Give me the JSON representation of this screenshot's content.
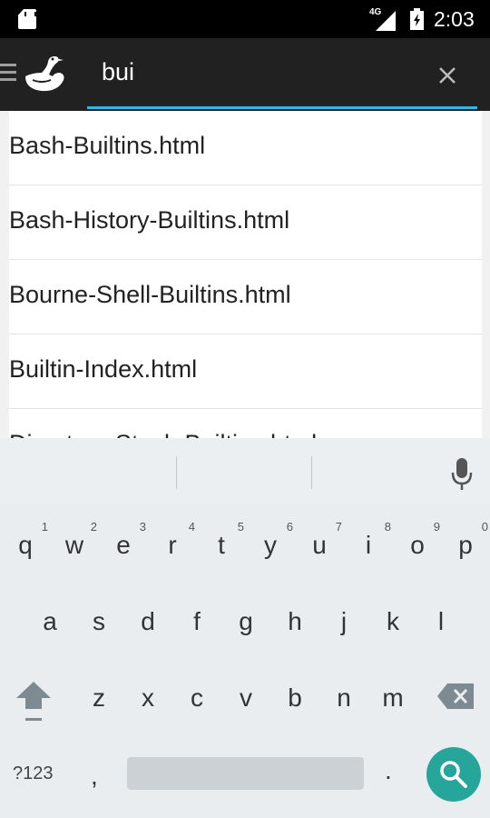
{
  "status_bar": {
    "network": "4G",
    "time": "2:03",
    "icons": [
      "sd-card-icon",
      "signal-icon",
      "battery-charging-icon"
    ]
  },
  "search": {
    "query": "bui",
    "icons": [
      "menu-icon",
      "duck-logo-icon",
      "clear-icon"
    ],
    "accent_color": "#33b5e5"
  },
  "results": [
    {
      "label": "Bash-Builtins.html"
    },
    {
      "label": "Bash-History-Builtins.html"
    },
    {
      "label": "Bourne-Shell-Builtins.html"
    },
    {
      "label": "Builtin-Index.html"
    },
    {
      "label": "Directory-Stack-Builtins.html"
    }
  ],
  "keyboard": {
    "row1": [
      {
        "key": "q",
        "hint": "1"
      },
      {
        "key": "w",
        "hint": "2"
      },
      {
        "key": "e",
        "hint": "3"
      },
      {
        "key": "r",
        "hint": "4"
      },
      {
        "key": "t",
        "hint": "5"
      },
      {
        "key": "y",
        "hint": "6"
      },
      {
        "key": "u",
        "hint": "7"
      },
      {
        "key": "i",
        "hint": "8"
      },
      {
        "key": "o",
        "hint": "9"
      },
      {
        "key": "p",
        "hint": "0"
      }
    ],
    "row2": [
      "a",
      "s",
      "d",
      "f",
      "g",
      "h",
      "j",
      "k",
      "l"
    ],
    "row3": [
      "z",
      "x",
      "c",
      "v",
      "b",
      "n",
      "m"
    ],
    "mode_label": "?123",
    "comma": ",",
    "period": ".",
    "search_key_color": "#26a69a",
    "icons": [
      "mic-icon",
      "shift-icon",
      "backspace-icon",
      "search-icon"
    ]
  }
}
